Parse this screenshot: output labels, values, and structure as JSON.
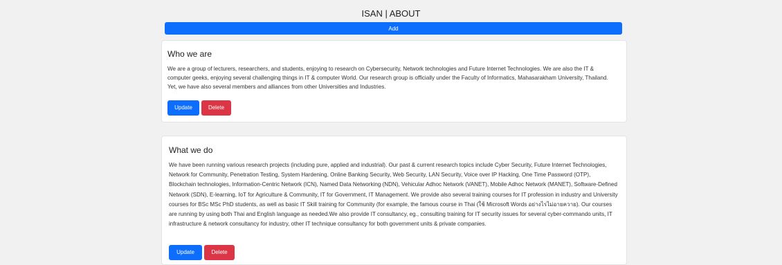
{
  "header": {
    "title": "ISAN | ABOUT",
    "add_label": "Add"
  },
  "cards": [
    {
      "title": "Who we are",
      "text": "We are a group of lecturers, researchers, and students, enjoying to research on Cybersecurity, Network technologies and Future Internet Technologies. We are also the IT & computer geeks, enjoying several challenging things in IT & computer World. Our research group is officially under the Faculty of Informatics, Mahasarakham University, Thailand. Yet, we have also several members and alliances from other Universities and Industries.",
      "update_label": "Update",
      "delete_label": "Delete"
    },
    {
      "title": "What we do",
      "text": "We have been running various research projects (including pure, applied and industrial). Our past & current research topics include Cyber Security, Future Internet Technologies, Network for Community, Penetration Testing, System Hardening, Online Banking Security, Web Security, LAN Security, Voice over IP Hacking, One Time Password (OTP), Blockchain technologies, Information-Centric Network (ICN), Named Data Networking (NDN), Vehicular Adhoc Network (VANET), Mobile Adhoc Network (MANET), Software-Defined Network (SDN), E-learning, IoT for Agriculture & Community, IT for Government, IT Management. We provide also several training courses for IT profession in industry and University courses for BSc MSc PhD students, as well as basic IT Skill training for Community (for example, the famous course in Thai (ใช้ Microsoft Words อย่างไรไม่อายควาย). Our courses are running by using both Thai and English language as needed.We also provide IT consultancy, eg., consulting training for IT security issues for several cyber-commando units, IT infrastructure & network consultancy for industry, other IT technique consultancy for both government units & private companies.",
      "update_label": "Update",
      "delete_label": "Delete"
    }
  ],
  "colors": {
    "primary": "#0d6efd",
    "danger": "#dc3545",
    "background": "#f1f1f1"
  }
}
